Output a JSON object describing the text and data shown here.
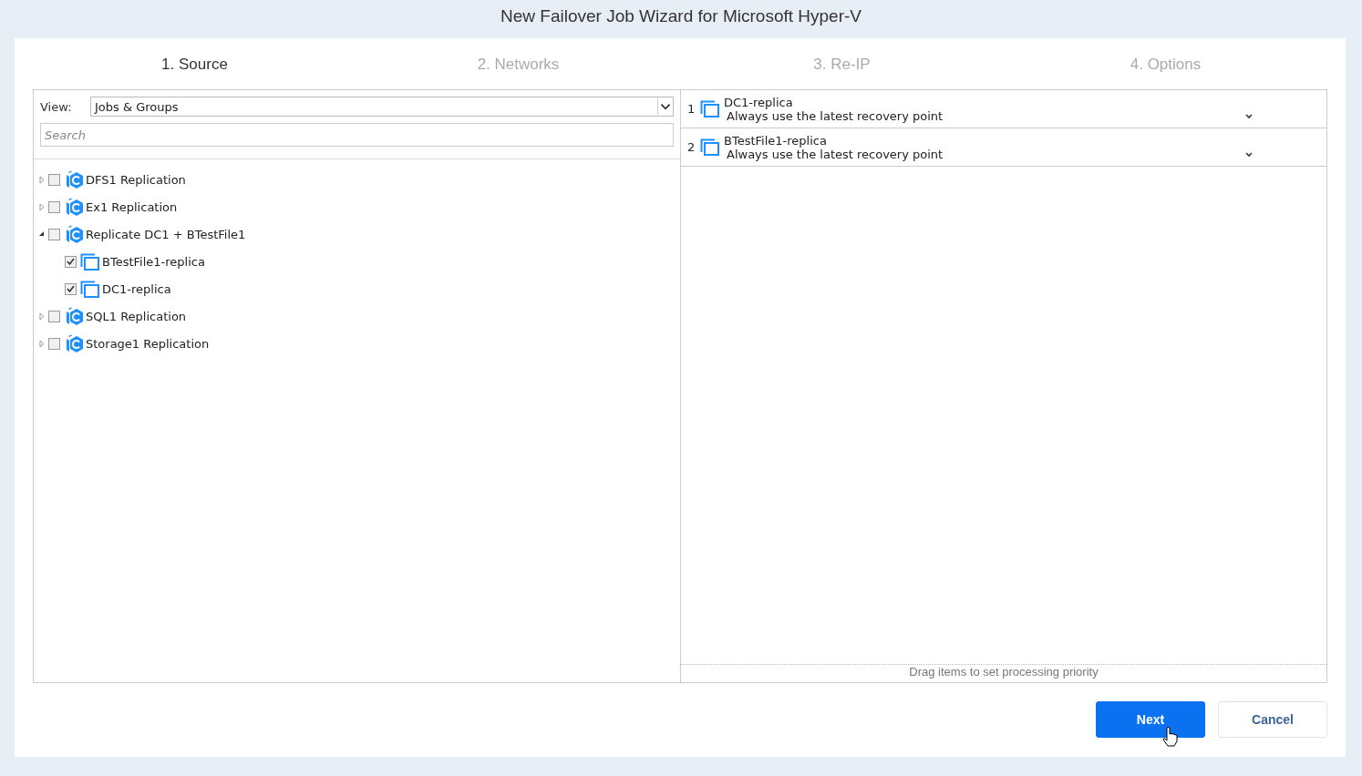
{
  "window": {
    "title": "New Failover Job Wizard for Microsoft Hyper-V"
  },
  "steps": [
    {
      "label": "1. Source",
      "selected": true
    },
    {
      "label": "2. Networks",
      "selected": false
    },
    {
      "label": "3. Re-IP",
      "selected": false
    },
    {
      "label": "4. Options",
      "selected": false
    }
  ],
  "view": {
    "label": "View:",
    "value": "Jobs & Groups"
  },
  "search": {
    "placeholder": "Search"
  },
  "tree": [
    {
      "kind": "job",
      "label": "DFS1 Replication",
      "expanded": false,
      "checked": false
    },
    {
      "kind": "job",
      "label": "Ex1 Replication",
      "expanded": false,
      "checked": false
    },
    {
      "kind": "job",
      "label": "Replicate DC1 + BTestFile1",
      "expanded": true,
      "checked": false,
      "children": [
        {
          "kind": "vm",
          "label": "BTestFile1-replica",
          "checked": true
        },
        {
          "kind": "vm",
          "label": "DC1-replica",
          "checked": true
        }
      ]
    },
    {
      "kind": "job",
      "label": "SQL1 Replication",
      "expanded": false,
      "checked": false
    },
    {
      "kind": "job",
      "label": "Storage1 Replication",
      "expanded": false,
      "checked": false
    }
  ],
  "selected_items": [
    {
      "index": "1",
      "name": "DC1-replica",
      "recovery_point": "Always use the latest recovery point"
    },
    {
      "index": "2",
      "name": "BTestFile1-replica",
      "recovery_point": "Always use the latest recovery point"
    }
  ],
  "hint": "Drag items to set processing priority",
  "buttons": [
    {
      "label": "Next",
      "kind": "primary"
    },
    {
      "label": "Cancel",
      "kind": "secondary"
    }
  ]
}
